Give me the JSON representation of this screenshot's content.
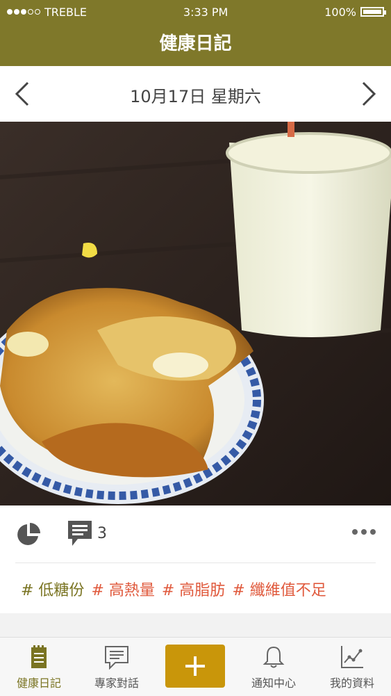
{
  "status": {
    "carrier": "TREBLE",
    "time": "3:33 PM",
    "battery": "100%"
  },
  "header": {
    "title": "健康日記"
  },
  "date_nav": {
    "date": "10月17日 星期六"
  },
  "actions": {
    "comment_count": "3"
  },
  "tags": [
    {
      "text": "# 低糖份",
      "color": "#7a7422"
    },
    {
      "text": "# 高熱量",
      "color": "#e05a3d"
    },
    {
      "text": "# 高脂肪",
      "color": "#e05a3d"
    },
    {
      "text": "# 纖維值不足",
      "color": "#e05a3d"
    }
  ],
  "tabbar": {
    "items": [
      {
        "label": "健康日記",
        "icon": "notebook-icon",
        "active": true
      },
      {
        "label": "專家對話",
        "icon": "chat-icon"
      },
      {
        "label": "",
        "icon": "plus-icon"
      },
      {
        "label": "通知中心",
        "icon": "bell-icon"
      },
      {
        "label": "我的資料",
        "icon": "chart-line-icon"
      }
    ]
  },
  "colors": {
    "header": "#7f782a",
    "accent": "#c9960a",
    "tag_green": "#7a7422",
    "tag_red": "#e05a3d"
  }
}
